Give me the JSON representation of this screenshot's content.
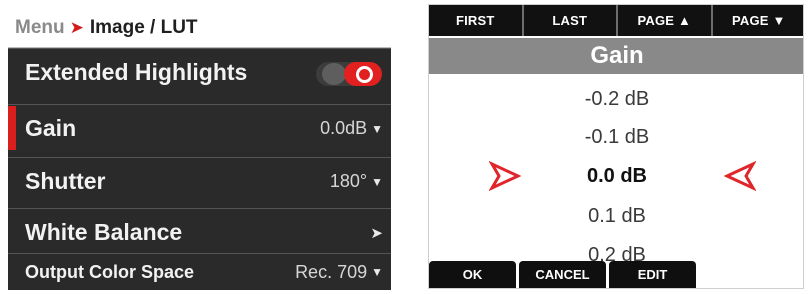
{
  "left_menu": {
    "breadcrumb": {
      "root": "Menu",
      "separator": "›",
      "current": "Image / LUT"
    },
    "items": [
      {
        "label": "Extended Highlights",
        "value": "",
        "control": "toggle",
        "state": "on"
      },
      {
        "label": "Gain",
        "value": "0.0dB",
        "control": "dropdown",
        "selected": true
      },
      {
        "label": "Shutter",
        "value": "180°",
        "control": "dropdown"
      },
      {
        "label": "White Balance",
        "value": "",
        "control": "submenu"
      },
      {
        "label": "Output Color Space",
        "value": "Rec. 709",
        "control": "dropdown"
      }
    ],
    "accent_color": "#d91e1e"
  },
  "right_panel": {
    "top_buttons": [
      "FIRST",
      "LAST",
      "PAGE ▲",
      "PAGE ▼"
    ],
    "title": "Gain",
    "options": [
      "-0.2 dB",
      "-0.1 dB",
      "0.0 dB",
      "0.1 dB",
      "0.2 dB"
    ],
    "selected_index": 2,
    "bottom_buttons": [
      "OK",
      "CANCEL",
      "EDIT"
    ],
    "marker_color": "#e0262a"
  }
}
